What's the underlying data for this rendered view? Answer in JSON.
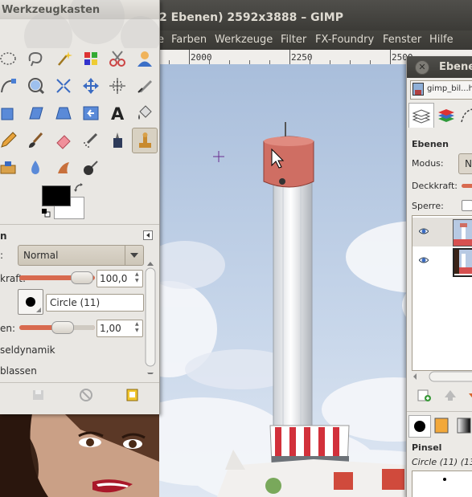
{
  "main_window": {
    "title": "2 Ebenen) 2592x3888 – GIMP",
    "menus": [
      "e",
      "Farben",
      "Werkzeuge",
      "Filter",
      "FX-Foundry",
      "Fenster",
      "Hilfe"
    ],
    "ruler_labels": [
      "2000",
      "2250",
      "2500"
    ]
  },
  "toolbox": {
    "title": "Werkzeugkasten",
    "tool_options": {
      "heading": "n",
      "mode_label": ":",
      "mode_value": "Normal",
      "opacity_label": "kraft:",
      "opacity_value": "100,0",
      "opacity_fraction": 1.0,
      "brush_name": "Circle (11)",
      "scale_label": "en:",
      "scale_value": "1,00",
      "dynamics_label": "seldynamik",
      "fade_label": "blassen"
    }
  },
  "layers_dock": {
    "title": "Ebenen",
    "image_name": "gimp_bil...h",
    "section_title": "Ebenen",
    "mode_label": "Modus:",
    "mode_value": "N",
    "opacity_label": "Deckkraft:",
    "lock_label": "Sperre:",
    "brush_section_title": "Pinsel",
    "brush_value": "Circle (11) (13"
  },
  "colors": {
    "foreground": "#000000",
    "background": "#ffffff",
    "accent": "#d86a4f"
  }
}
